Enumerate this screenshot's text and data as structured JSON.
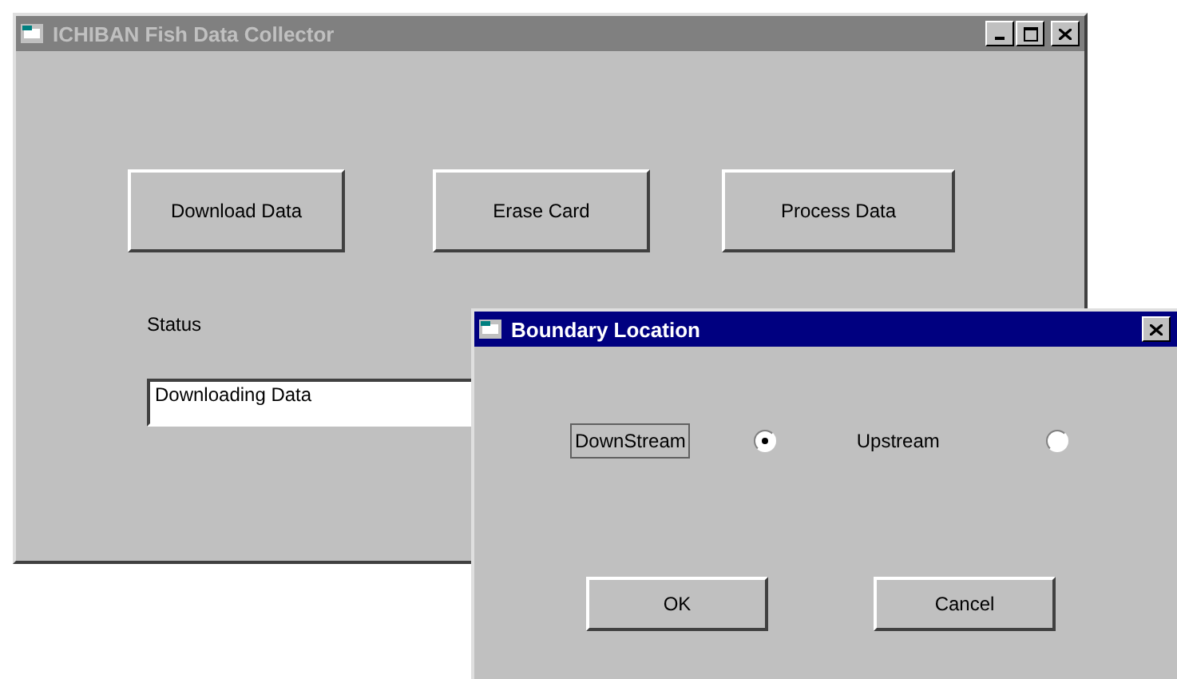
{
  "main_window": {
    "title": "ICHIBAN Fish Data Collector",
    "active": false,
    "buttons": [
      "Download Data",
      "Erase Card",
      "Process Data"
    ],
    "status_label": "Status",
    "status_field": {
      "value": "Downloading Data"
    }
  },
  "dialog": {
    "title": "Boundary Location",
    "active": true,
    "options": [
      {
        "label": "DownStream",
        "selected": true,
        "focused": true
      },
      {
        "label": "Upstream",
        "selected": false,
        "focused": false
      }
    ],
    "buttons": [
      "OK",
      "Cancel"
    ]
  }
}
